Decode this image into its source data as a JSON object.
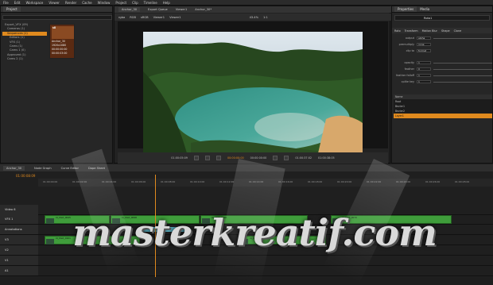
{
  "menu": [
    "File",
    "Edit",
    "Workspace",
    "Viewer",
    "Render",
    "Cache",
    "Window",
    "Project",
    "Clip",
    "Timeline",
    "Help"
  ],
  "project": {
    "tab": "Project",
    "tree": [
      "Export_VFX (09)",
      "Cameras (1)",
      "Sequences (1)",
      "Editors (1)",
      "VFX (1)",
      "Cams (1)",
      "Cams 1 (0)",
      "Approved (1)",
      "Cams 2 (1)"
    ],
    "selected_index": 2,
    "thumb_title": "s8",
    "thumb_lines": [
      "Anchor_30",
      "1920x1080",
      "00:00:00:00",
      "00:00:03:00"
    ]
  },
  "viewer": {
    "tabs": [
      "Anchor_30",
      "Export Queue",
      "Viewer1",
      "Anchor_30*"
    ],
    "toolbar": [
      "rgba",
      "RGB",
      "sRGB",
      "Viewer1",
      "Viewer1",
      "43.4%",
      "1:1"
    ],
    "timecodes": [
      "01:00:05:09",
      "00:00:00:00",
      "00:00:00:00",
      "01:00:37:02",
      "01:00:38:05"
    ]
  },
  "properties": {
    "tabs": [
      "Properties",
      "Media"
    ],
    "node": "Roto1",
    "subtabs": [
      "Roto",
      "Transform",
      "Motion Blur",
      "Shape",
      "Clone"
    ],
    "rows": [
      {
        "label": "output",
        "value": "alpha"
      },
      {
        "label": "premultiply",
        "value": "none"
      },
      {
        "label": "clip to",
        "value": "format"
      },
      {
        "label": "opacity",
        "value": "1"
      },
      {
        "label": "feather",
        "value": "0"
      },
      {
        "label": "feather falloff",
        "value": "1"
      },
      {
        "label": "cplite key",
        "value": "1"
      }
    ],
    "nodes": [
      "Name",
      "Root",
      "Bezier1",
      "Bezier2",
      "Layer1"
    ],
    "selected_node": 4
  },
  "timeline": {
    "tabs": [
      "Anchor_30",
      "Node Graph",
      "Curve Editor",
      "Dope Sheet"
    ],
    "timecode": "01:00:08:09",
    "ticks": [
      "01:00:00:00",
      "01:00:02:00",
      "01:00:04:00",
      "01:00:06:00",
      "01:00:08:00",
      "01:00:10:00",
      "01:00:12:00",
      "01:00:14:00",
      "01:00:16:00",
      "01:00:18:00",
      "01:00:20:00",
      "01:00:22:00",
      "01:00:24:00",
      "01:00:26:00",
      "01:00:28:00"
    ],
    "tracks": [
      "Video 6",
      "VFX 1",
      "Annotations",
      "V3",
      "V2",
      "V1",
      "A1"
    ],
    "clips": [
      "Id_Shot_0045",
      "Id_Shot_0098",
      "Id_Shot_0060",
      "Id_Shot_0070",
      "Id_Shot_0101",
      "Id_Shot_0128"
    ]
  },
  "watermark": "masterkreatif.com",
  "colors": {
    "accent": "#e08a1e",
    "clip": "#3f9d3b"
  }
}
